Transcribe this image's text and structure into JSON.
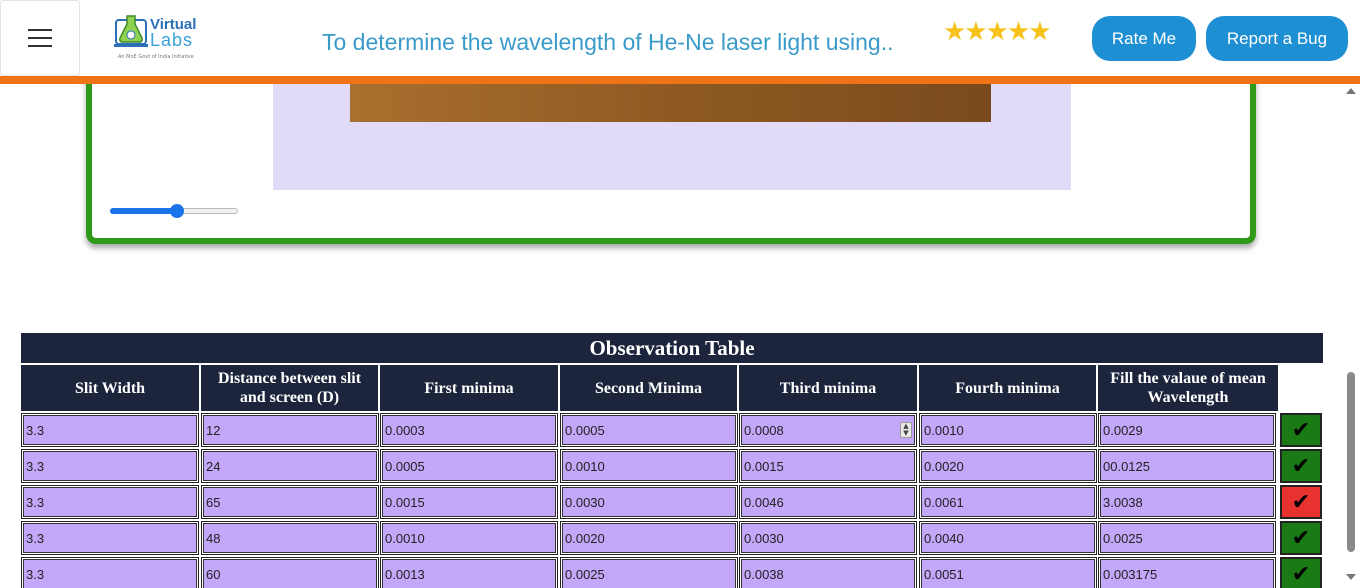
{
  "header": {
    "logo_line1": "Virtual",
    "logo_line2": "Labs",
    "logo_sub": "An MoE Govt of India Initiative",
    "title": "To determine the wavelength of He-Ne laser light using..",
    "stars": "★★★★★",
    "rate_label": "Rate Me",
    "bug_label": "Report a Bug"
  },
  "simulation": {
    "slider_value": 0.5
  },
  "table": {
    "title": "Observation Table",
    "headers": [
      "Slit Width",
      "Distance between slit and screen (D)",
      "First minima",
      "Second Minima",
      "Third minima",
      "Fourth minima",
      "Fill the valaue of mean Wavelength"
    ],
    "rows": [
      {
        "cells": [
          "3.3",
          "12",
          "0.0003",
          "0.0005",
          "0.0008",
          "0.0010",
          "0.0029"
        ],
        "status": "correct"
      },
      {
        "cells": [
          "3.3",
          "24",
          "0.0005",
          "0.0010",
          "0.0015",
          "0.0020",
          "00.0125"
        ],
        "status": "correct"
      },
      {
        "cells": [
          "3.3",
          "65",
          "0.0015",
          "0.0030",
          "0.0046",
          "0.0061",
          "3.0038"
        ],
        "status": "incorrect"
      },
      {
        "cells": [
          "3.3",
          "48",
          "0.0010",
          "0.0020",
          "0.0030",
          "0.0040",
          "0.0025"
        ],
        "status": "correct"
      },
      {
        "cells": [
          "3.3",
          "60",
          "0.0013",
          "0.0025",
          "0.0038",
          "0.0051",
          "0.003175"
        ],
        "status": "correct"
      }
    ],
    "check_glyph": "✔",
    "colors": {
      "correct": "#1a7a16",
      "incorrect": "#e8322f",
      "header_bg": "#1c253c",
      "input_bg": "#c3a8f9"
    }
  }
}
